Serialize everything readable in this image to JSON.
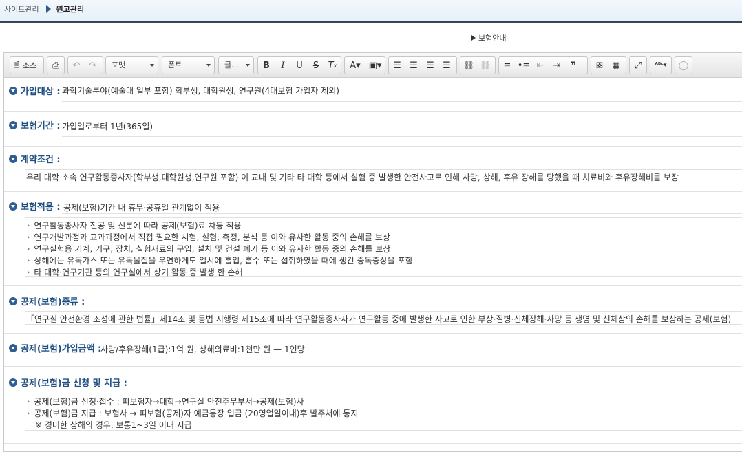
{
  "breadcrumb": {
    "root": "사이트관리",
    "current": "원고관리"
  },
  "notice_link": "보험안내",
  "toolbar": {
    "source_label": "소스",
    "format_label": "포맷",
    "font_label": "폰트",
    "size_label": "글..."
  },
  "sections": {
    "eligibility": {
      "label": "가입대상 :",
      "text": "과학기술분야(예술대 일부 포함) 학부생, 대학원생, 연구원(4대보험 가입자 제외)"
    },
    "period": {
      "label": "보험기간 :",
      "text": "가입일로부터 1년(365일)"
    },
    "contract": {
      "label": "계약조건 :",
      "text": "우리 대학 소속 연구활동종사자(학부생,대학원생,연구원 포함) 이 교내 및 기타 타 대학 등에서 실험 중 발생한 안전사고로 인해 사망, 상해, 후유 장해를 당했을 때 치료비와 후유장해비를 보장"
    },
    "coverage": {
      "label": "보험적용 :",
      "text": "공제(보험)기간 내 휴무·공휴일 관계없이 적용",
      "items": [
        "연구활동종사자 전공 및 신분에 따라 공제(보험)료 차등 적용",
        "연구개발과정과 교과과정에서 직접 필요한 시험, 실험, 측정, 분석 등 이와 유사한 활동 중의 손해를 보상",
        "연구실험용 기계, 기구, 장치, 실험재료의 구입, 설치 및 건설 폐기 등 이와 유사한 활동 중의 손해를 보상",
        "상해에는 유독가스 또는 유독물질을 우연하게도 일시에 흡입, 흡수 또는 섭취하였을 때에 생긴 중독증상을 포함",
        "타 대학·연구기관 등의 연구실에서 상기 활동 중 발생 한 손해"
      ]
    },
    "type": {
      "label": "공제(보험)종류 :",
      "text": "「연구실 안전환경 조성에 관한 법률」제14조 및 동법 시행령 제15조에 따라 연구활동종사자가 연구활동 중에 발생한 사고로 인한 부상·질병·신체장해·사망 등 생명 및 신체상의 손해를 보상하는 공제(보험)"
    },
    "amount": {
      "label": "공제(보험)가입금액 :",
      "text": "사망/후유장해(1급):1억 원, 상해의료비:1천만 원 — 1인당"
    },
    "claim": {
      "label": "공제(보험)금 신청 및 지급 :",
      "items": [
        "공제(보험)금 신청·접수 : 피보험자→대학→연구실 안전주무부서→공제(보험)사",
        "공제(보험)금 지급 : 보험사 → 피보험(공제)자 예금통장 입금 (20영업일이내)후 발주처에 통지"
      ],
      "note": "※ 경미한 상해의 경우, 보통1~3일 이내 지급"
    }
  }
}
